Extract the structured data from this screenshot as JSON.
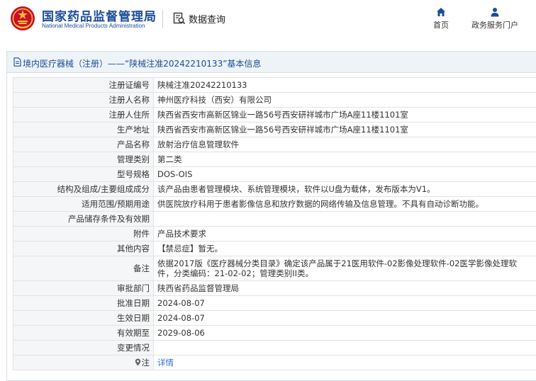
{
  "header": {
    "org_name_cn": "国家药品监督管理局",
    "org_name_en": "National Medical Products Administration",
    "query_title": "数据查询",
    "nav": {
      "home": "首页",
      "gov_portal": "政务服务门户"
    }
  },
  "colors": {
    "brand_blue": "#1a4d99",
    "emblem_red": "#c8102e",
    "nav_blue": "#1a4d99",
    "link_blue": "#2a6fc9",
    "label_bg": "#f5f6f8"
  },
  "panel": {
    "heading": "境内医疗器械（注册）——“陕械注准20242210133”基本信息"
  },
  "record": {
    "rows": [
      {
        "label": "注册证编号",
        "value": "陕械注准20242210133"
      },
      {
        "label": "注册人名称",
        "value": "神州医疗科技（西安）有限公司"
      },
      {
        "label": "注册人住所",
        "value": "陕西省西安市高新区锦业一路56号西安研祥城市广场A座11楼1101室"
      },
      {
        "label": "生产地址",
        "value": "陕西省西安市高新区锦业一路56号西安研祥城市广场A座11楼1101室"
      },
      {
        "label": "产品名称",
        "value": "放射治疗信息管理软件"
      },
      {
        "label": "管理类别",
        "value": "第二类"
      },
      {
        "label": "型号规格",
        "value": "DOS-OIS"
      },
      {
        "label": "结构及组成/主要组成成分",
        "value": "该产品由患者管理模块、系统管理模块，软件以U盘为载体，发布版本为V1。"
      },
      {
        "label": "适用范围/预期用途",
        "value": "供医院放疗科用于患者影像信息和放疗数据的网络传输及信息管理。不具有自动诊断功能。"
      },
      {
        "label": "产品储存条件及有效期",
        "value": ""
      },
      {
        "label": "附件",
        "value": "产品技术要求"
      },
      {
        "label": "其他内容",
        "value": "【禁忌症】暂无。"
      },
      {
        "label": "备注",
        "value": "依据2017版《医疗器械分类目录》确定该产品属于21医用软件-02影像处理软件-02医学影像处理软件，分类编码：21-02-02；管理类别II类。"
      },
      {
        "label": "审批部门",
        "value": "陕西省药品监督管理局"
      },
      {
        "label": "批准日期",
        "value": "2024-08-07"
      },
      {
        "label": "生效日期",
        "value": "2024-08-07"
      },
      {
        "label": "有效期至",
        "value": "2029-08-06"
      },
      {
        "label": "变更情况",
        "value": ""
      }
    ],
    "note_label": "注",
    "note_link": "详情"
  }
}
